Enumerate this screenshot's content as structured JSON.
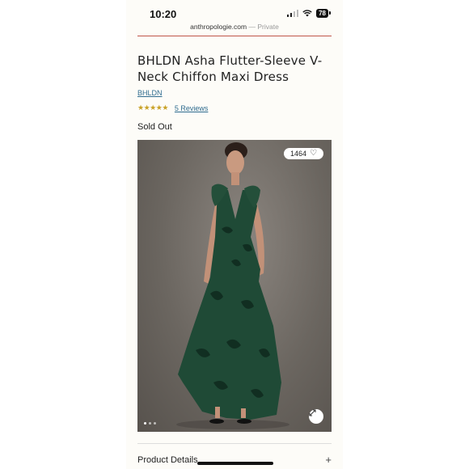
{
  "status_bar": {
    "time": "10:20",
    "battery": "78"
  },
  "browser": {
    "domain": "anthropologie.com",
    "separator": " — ",
    "mode": "Private"
  },
  "product": {
    "title": "BHLDN Asha Flutter-Sleeve V-Neck Chiffon Maxi Dress",
    "brand": "BHLDN",
    "rating": 4.5,
    "rating_max": 5,
    "reviews_label": "5 Reviews",
    "stock_status": "Sold Out"
  },
  "gallery": {
    "like_count": "1464",
    "image_count": 3,
    "active_index": 0,
    "dress_color": "#1f4a36",
    "background_color": "#6b6660"
  },
  "sections": {
    "details_label": "Product Details"
  },
  "colors": {
    "link": "#2f6c8f",
    "star": "#c9a227",
    "accent_line": "#c0564a"
  }
}
